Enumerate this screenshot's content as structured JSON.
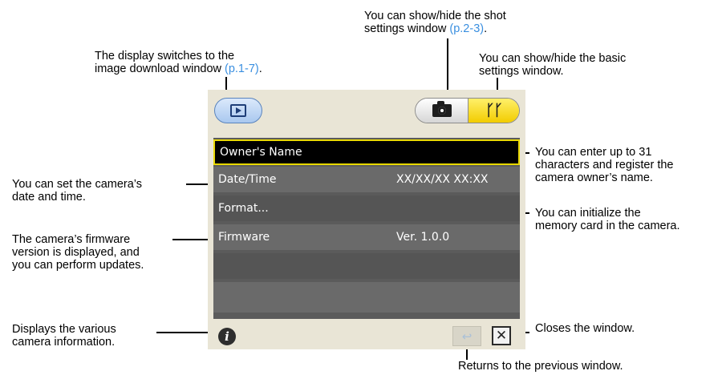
{
  "annotations": {
    "shot_settings_line1": "You can show/hide the shot",
    "shot_settings_line2_pre": "settings window ",
    "shot_settings_link": "(p.2-3)",
    "shot_settings_line2_post": ".",
    "download_line1": "The display switches to the",
    "download_line2_pre": "image download window ",
    "download_link": "(p.1-7)",
    "download_line2_post": ".",
    "basic_line1": "You can show/hide the basic",
    "basic_line2": "settings window.",
    "owner_line1": "You can enter up to 31",
    "owner_line2": "characters and register the",
    "owner_line3": "camera owner’s name.",
    "datetime_line1": "You can set the camera’s",
    "datetime_line2": "date and time.",
    "format_line1": "You can initialize the",
    "format_line2": "memory card in the camera.",
    "firmware_line1": "The camera’s firmware",
    "firmware_line2": "version is displayed, and",
    "firmware_line3": "you can perform updates.",
    "info_line1": "Displays the various",
    "info_line2": "camera information.",
    "close_text": "Closes the window.",
    "back_text": "Returns to the previous window."
  },
  "window": {
    "rows": [
      {
        "label": "Owner's Name",
        "value": ""
      },
      {
        "label": "Date/Time",
        "value": "XX/XX/XX XX:XX"
      },
      {
        "label": "Format...",
        "value": ""
      },
      {
        "label": "Firmware",
        "value": "Ver. 1.0.0"
      }
    ],
    "info_glyph": "i",
    "back_glyph": "↩",
    "close_glyph": "✕"
  },
  "colors": {
    "link": "#3a8fe0",
    "selected_border": "#e8d800",
    "basic_button": "#f2cc00",
    "play_button": "#a9c8ef",
    "list_bg": "#5b5b5b"
  },
  "icons": [
    "playback-icon",
    "camera-icon",
    "wrench-icon",
    "info-icon",
    "back-icon",
    "close-icon"
  ]
}
